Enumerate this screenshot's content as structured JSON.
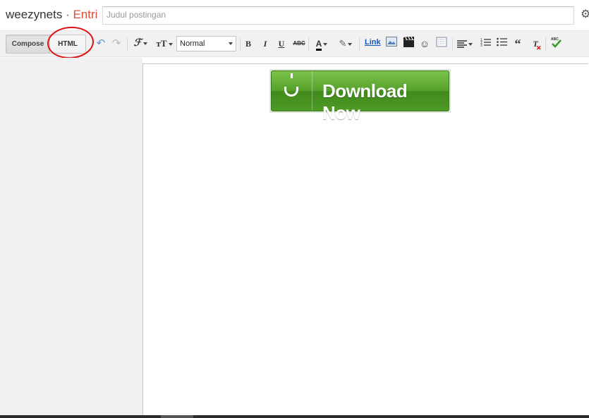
{
  "header": {
    "blog_name": "weezynets",
    "separator": "·",
    "section": "Entri",
    "title_placeholder": "Judul postingan",
    "settings_icon": "gear-icon"
  },
  "toolbar": {
    "compose_label": "Compose",
    "html_label": "HTML",
    "format_value": "Normal",
    "link_label": "Link",
    "icons": [
      "undo-icon",
      "redo-icon",
      "font-family-icon",
      "font-size-icon",
      "bold-icon",
      "italic-icon",
      "underline-icon",
      "strikethrough-icon",
      "text-color-icon",
      "highlight-icon",
      "link",
      "image-icon",
      "video-icon",
      "emoji-icon",
      "jump-break-icon",
      "align-icon",
      "numbered-list-icon",
      "bulleted-list-icon",
      "quote-icon",
      "remove-format-icon",
      "spellcheck-icon"
    ]
  },
  "editor": {
    "download_button_text": "Download Now"
  },
  "colors": {
    "accent_red": "#dd4b39",
    "link_blue": "#1155cc",
    "button_green": "#55a12a",
    "annotation_red": "#dd1111"
  }
}
